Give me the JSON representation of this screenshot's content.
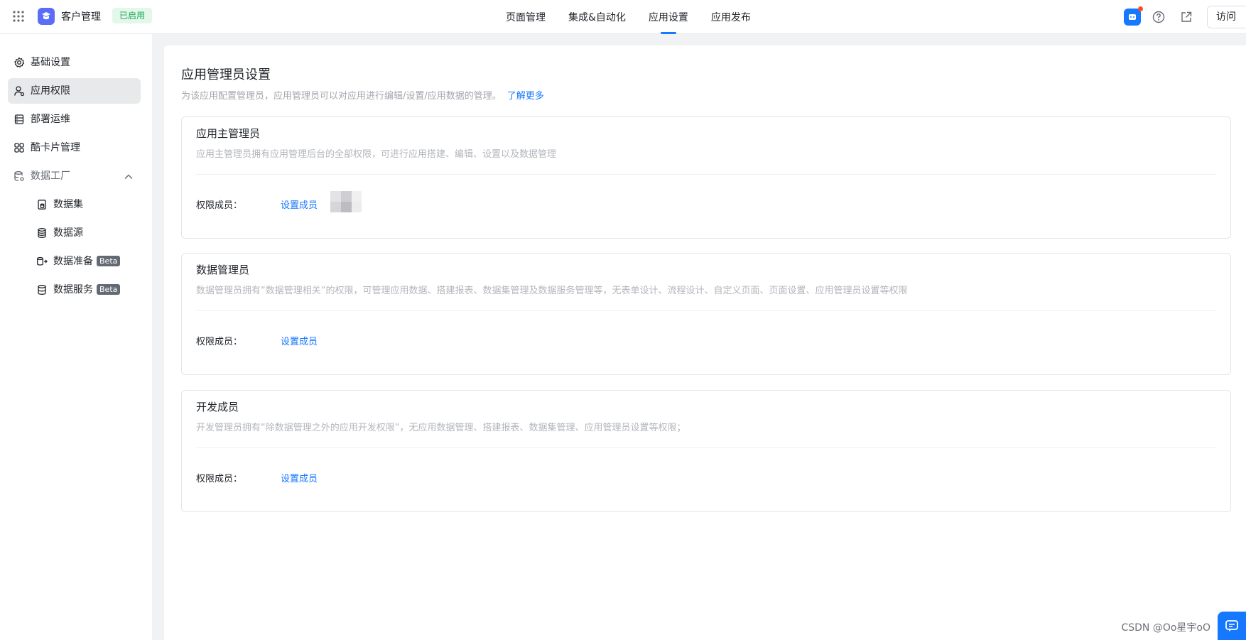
{
  "header": {
    "app_name": "客户管理",
    "status_badge": "已启用",
    "tabs": [
      {
        "label": "页面管理",
        "active": false
      },
      {
        "label": "集成&自动化",
        "active": false
      },
      {
        "label": "应用设置",
        "active": true
      },
      {
        "label": "应用发布",
        "active": false
      }
    ],
    "visit_label": "访问"
  },
  "sidebar": {
    "items": [
      {
        "label": "基础设置",
        "icon": "gear-icon"
      },
      {
        "label": "应用权限",
        "icon": "user-icon",
        "active": true
      },
      {
        "label": "部署运维",
        "icon": "server-icon"
      },
      {
        "label": "酷卡片管理",
        "icon": "cards-icon"
      },
      {
        "label": "数据工厂",
        "icon": "database-gear-icon",
        "expanded": true
      },
      {
        "label": "数据集",
        "icon": "dataset-icon"
      },
      {
        "label": "数据源",
        "icon": "database-icon"
      },
      {
        "label": "数据准备",
        "icon": "data-prep-icon",
        "badge": "Beta"
      },
      {
        "label": "数据服务",
        "icon": "data-service-icon",
        "badge": "Beta"
      }
    ]
  },
  "main": {
    "title": "应用管理员设置",
    "description": "为该应用配置管理员，应用管理员可以对应用进行编辑/设置/应用数据的管理。",
    "learn_more": "了解更多",
    "cards": [
      {
        "title": "应用主管理员",
        "description": "应用主管理员拥有应用管理后台的全部权限，可进行应用搭建、编辑、设置以及数据管理",
        "member_label": "权限成员：",
        "action": "设置成员",
        "has_avatar": true
      },
      {
        "title": "数据管理员",
        "description": "数据管理员拥有“数据管理相关”的权限，可管理应用数据、搭建报表、数据集管理及数据服务管理等，无表单设计、流程设计、自定义页面、页面设置、应用管理员设置等权限",
        "member_label": "权限成员：",
        "action": "设置成员",
        "has_avatar": false
      },
      {
        "title": "开发成员",
        "description": "开发管理员拥有“除数据管理之外的应用开发权限”，无应用数据管理、搭建报表、数据集管理、应用管理员设置等权限；",
        "member_label": "权限成员：",
        "action": "设置成员",
        "has_avatar": false
      }
    ]
  },
  "watermark": "CSDN @Oo星宇oO",
  "colors": {
    "accent": "#1677ff",
    "badge_green": "#1fa85a",
    "logo": "#5b6cf9"
  }
}
